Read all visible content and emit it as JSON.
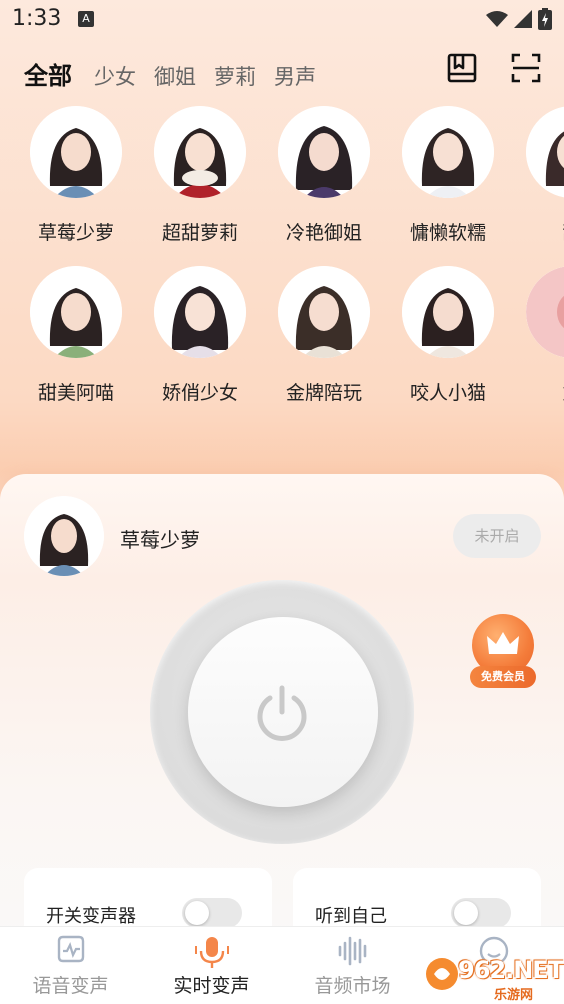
{
  "status_bar": {
    "time": "1:33",
    "notification_letter": "A"
  },
  "header": {
    "tabs": [
      {
        "label": "全部",
        "active": true
      },
      {
        "label": "少女",
        "active": false
      },
      {
        "label": "御姐",
        "active": false
      },
      {
        "label": "萝莉",
        "active": false
      },
      {
        "label": "男声",
        "active": false
      }
    ],
    "icons": [
      "book-icon",
      "scan-icon"
    ]
  },
  "voices": {
    "row1": [
      "草莓少萝",
      "超甜萝莉",
      "冷艳御姐",
      "慵懒软糯",
      "甜"
    ],
    "row2": [
      "甜美阿喵",
      "娇俏少女",
      "金牌陪玩",
      "咬人小猫",
      "娇"
    ]
  },
  "panel": {
    "selected_voice": "草莓少萝",
    "status_button": "未开启",
    "vip_label": "免费会员",
    "toggles": [
      {
        "label": "开关变声器",
        "on": false
      },
      {
        "label": "听到自己",
        "on": false
      }
    ]
  },
  "nav": {
    "items": [
      {
        "label": "语音变声",
        "icon": "waveform-monitor-icon",
        "active": false
      },
      {
        "label": "实时变声",
        "icon": "microphone-icon",
        "active": true
      },
      {
        "label": "音频市场",
        "icon": "audio-wave-icon",
        "active": false
      },
      {
        "label": "",
        "icon": "smiley-icon",
        "active": false
      }
    ]
  },
  "watermark": {
    "brand": "962.NET",
    "sub": "乐游网"
  },
  "colors": {
    "accent": "#f47c3a",
    "background_top": "#fde9dd"
  }
}
